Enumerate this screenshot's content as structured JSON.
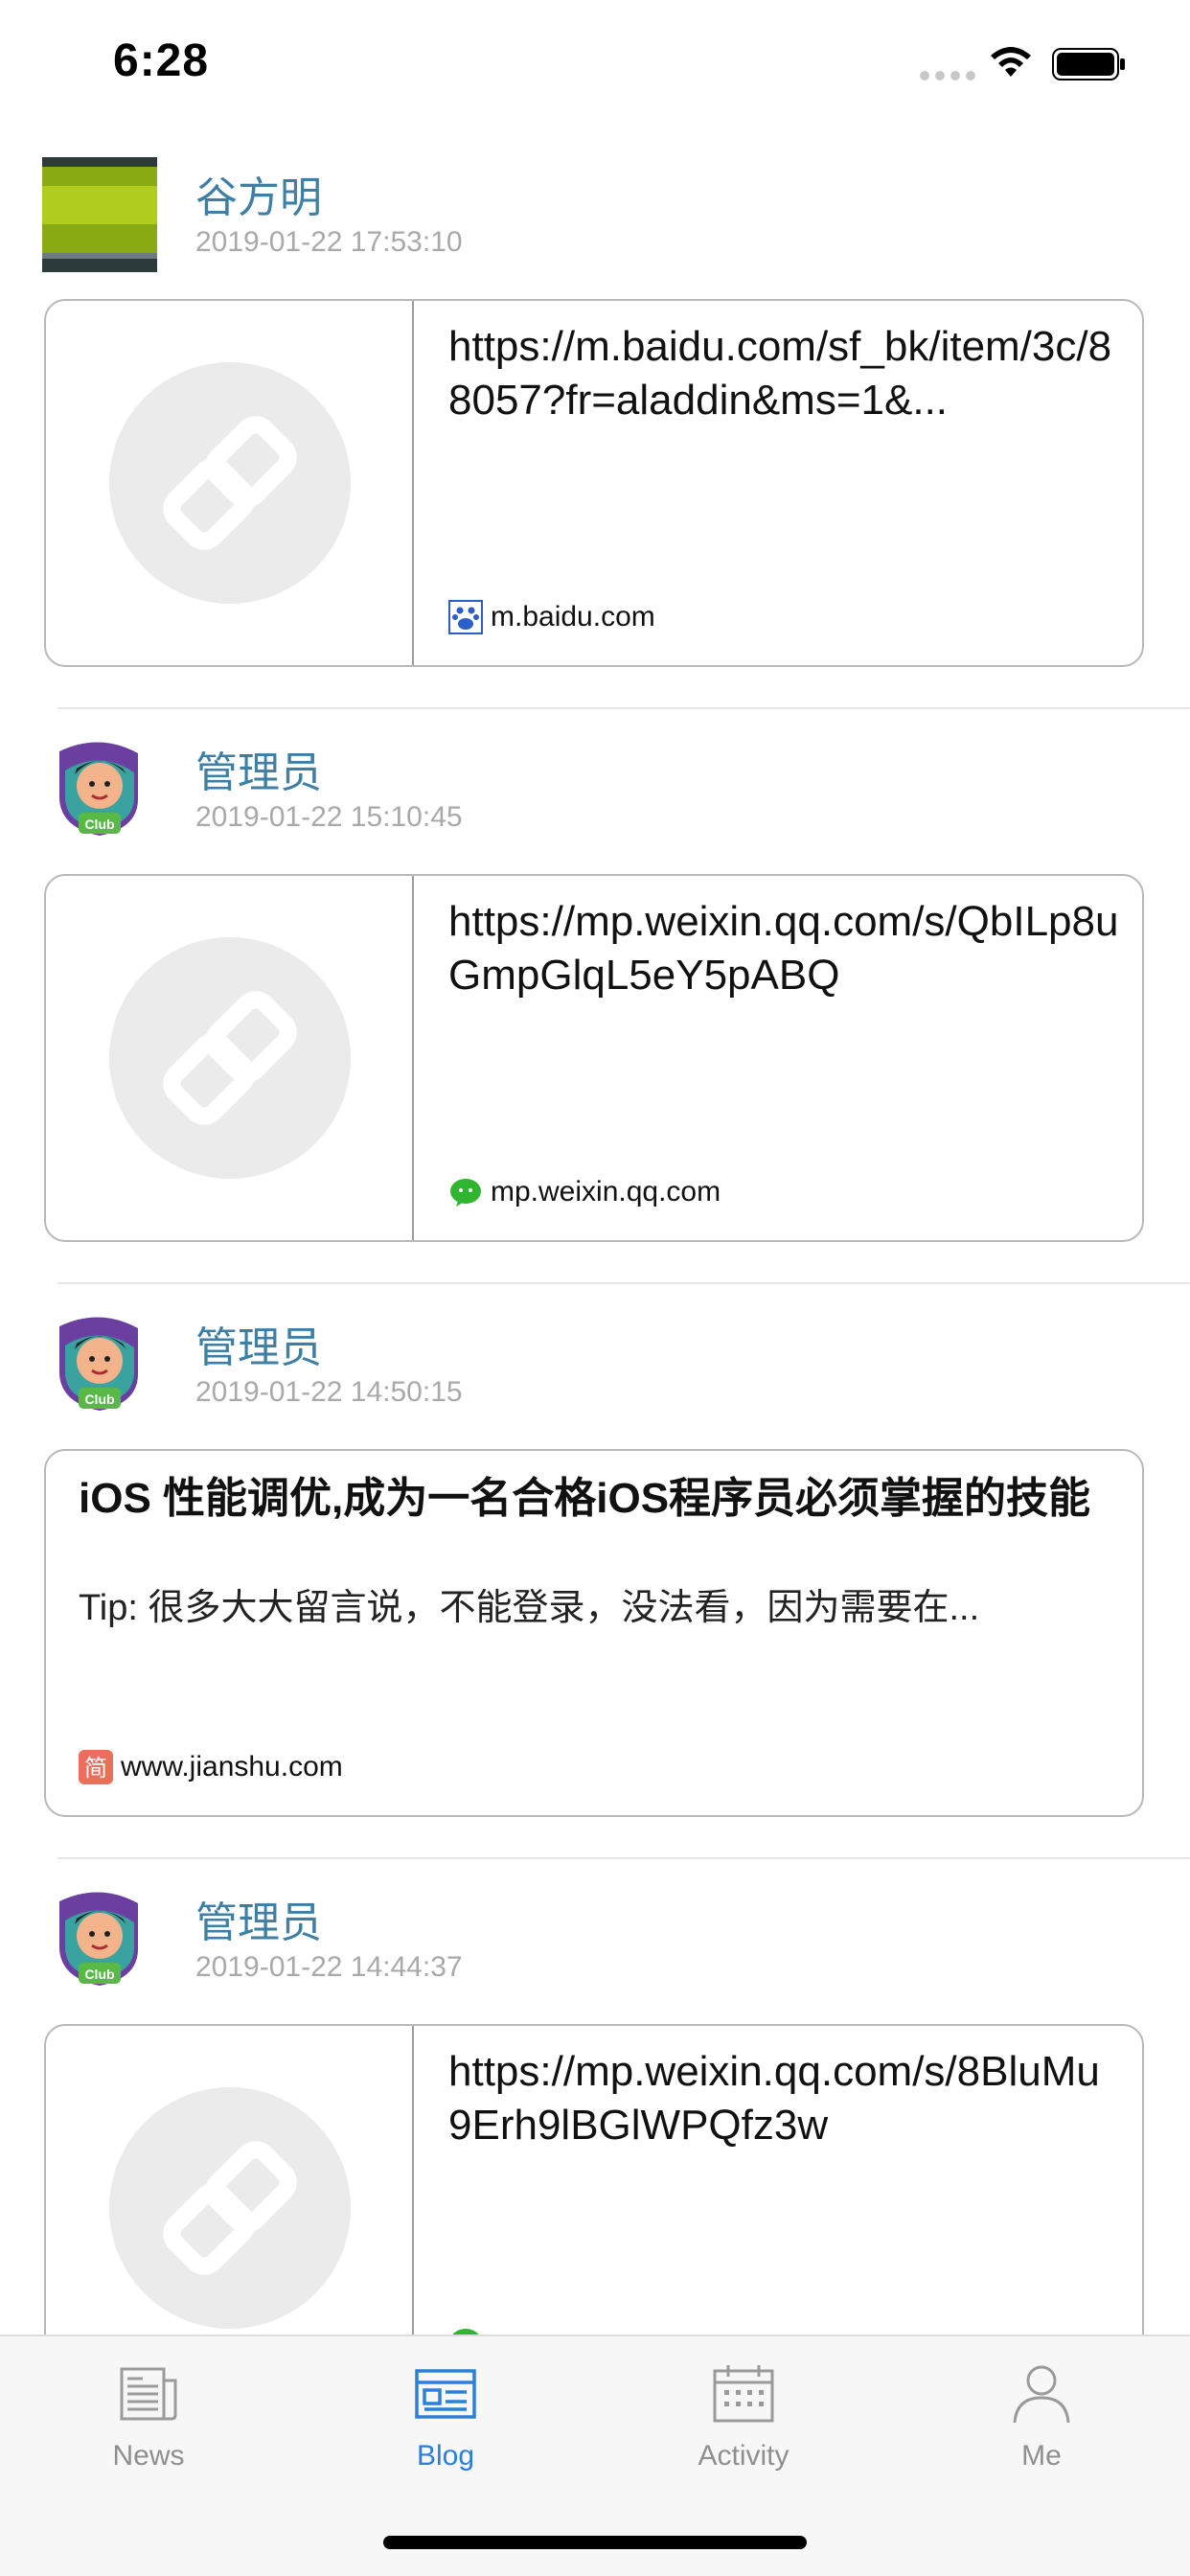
{
  "status_bar": {
    "time": "6:28"
  },
  "posts": [
    {
      "author": "谷方明",
      "timestamp": "2019-01-22 17:53:10",
      "avatar": "green-landscape-avatar",
      "card": {
        "type": "link",
        "url": "https://m.baidu.com/sf_bk/item/3c/88057?fr=aladdin&ms=1&...",
        "source": "m.baidu.com",
        "favicon": "baidu-icon"
      }
    },
    {
      "author": "管理员",
      "timestamp": "2019-01-22 15:10:45",
      "avatar": "student-club-avatar",
      "card": {
        "type": "link",
        "url": "https://mp.weixin.qq.com/s/QbILp8uGmpGlqL5eY5pABQ",
        "source": "mp.weixin.qq.com",
        "favicon": "wechat-icon"
      }
    },
    {
      "author": "管理员",
      "timestamp": "2019-01-22 14:50:15",
      "avatar": "student-club-avatar",
      "card": {
        "type": "article",
        "title": "iOS 性能调优,成为一名合格iOS程序员必须掌握的技能",
        "description": "Tip: 很多大大留言说，不能登录，没法看，因为需要在...",
        "source": "www.jianshu.com",
        "favicon": "jianshu-icon"
      }
    },
    {
      "author": "管理员",
      "timestamp": "2019-01-22 14:44:37",
      "avatar": "student-club-avatar",
      "card": {
        "type": "link",
        "url": "https://mp.weixin.qq.com/s/8BluMu9Erh9lBGlWPQfz3w",
        "source": "",
        "favicon": "wechat-icon"
      }
    }
  ],
  "tab_bar": {
    "active": "Blog",
    "tabs": [
      {
        "label": "News",
        "icon": "newspaper-icon"
      },
      {
        "label": "Blog",
        "icon": "blog-icon"
      },
      {
        "label": "Activity",
        "icon": "calendar-icon"
      },
      {
        "label": "Me",
        "icon": "person-icon"
      }
    ]
  },
  "colors": {
    "author": "#3f7fa6",
    "timestamp": "#a9a9a9",
    "tab_active": "#2a80d8",
    "tab_inactive": "#8f8f8f"
  }
}
